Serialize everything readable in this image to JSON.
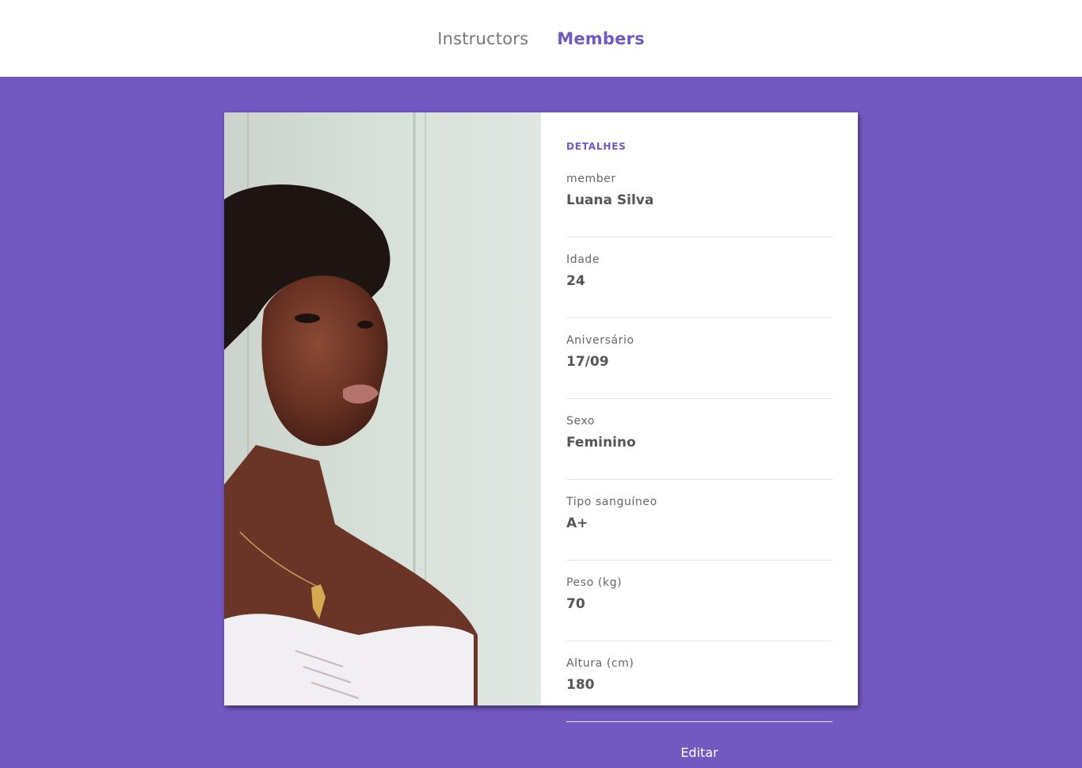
{
  "nav": {
    "items": [
      {
        "label": "Instructors",
        "active": false
      },
      {
        "label": "Members",
        "active": true
      }
    ]
  },
  "colors": {
    "accent": "#7159c1",
    "background": "#7159c1",
    "card": "#ffffff"
  },
  "details": {
    "title": "Detalhes",
    "fields": [
      {
        "label": "member",
        "value": "Luana Silva"
      },
      {
        "label": "Idade",
        "value": "24"
      },
      {
        "label": "Aniversário",
        "value": "17/09"
      },
      {
        "label": "Sexo",
        "value": "Feminino"
      },
      {
        "label": "Tipo sanguíneo",
        "value": "A+"
      },
      {
        "label": "Peso (kg)",
        "value": "70"
      },
      {
        "label": "Altura (cm)",
        "value": "180"
      }
    ],
    "edit_label": "Editar"
  }
}
